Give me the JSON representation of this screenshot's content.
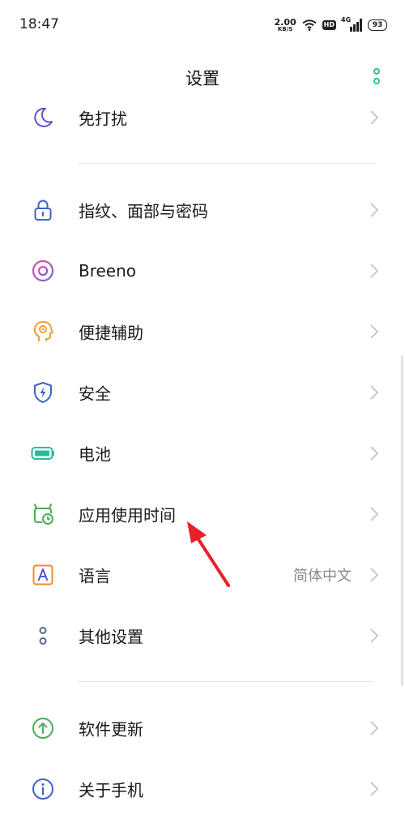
{
  "status": {
    "time": "18:47",
    "net_speed": "2.00",
    "net_speed_unit": "KB/S",
    "hd": "HD",
    "network": "4G",
    "battery": "93"
  },
  "header": {
    "title": "设置",
    "more_icon": "more-vertical-icon"
  },
  "settings": [
    {
      "label": "免打扰",
      "icon": "moon-icon",
      "color": "#5b55c9"
    },
    {
      "label": "指纹、面部与密码",
      "icon": "lock-icon",
      "color": "#3f63c8"
    },
    {
      "label": "Breeno",
      "icon": "breeno-icon",
      "color": "#c94fd0"
    },
    {
      "label": "便捷辅助",
      "icon": "assist-head-icon",
      "color": "#f0a13a"
    },
    {
      "label": "安全",
      "icon": "shield-icon",
      "color": "#3f63c8"
    },
    {
      "label": "电池",
      "icon": "battery-icon",
      "color": "#28b99a"
    },
    {
      "label": "应用使用时间",
      "icon": "app-timer-icon",
      "color": "#4bae59"
    },
    {
      "label": "语言",
      "value": "简体中文",
      "icon": "language-icon",
      "color": "#f08a2c"
    },
    {
      "label": "其他设置",
      "icon": "other-settings-icon",
      "color": "#5b6b88"
    },
    {
      "label": "软件更新",
      "icon": "update-icon",
      "color": "#4bae59"
    },
    {
      "label": "关于手机",
      "icon": "info-icon",
      "color": "#3f63c8"
    }
  ],
  "annotation": {
    "icon": "red-arrow-icon",
    "color": "#e8202a"
  }
}
